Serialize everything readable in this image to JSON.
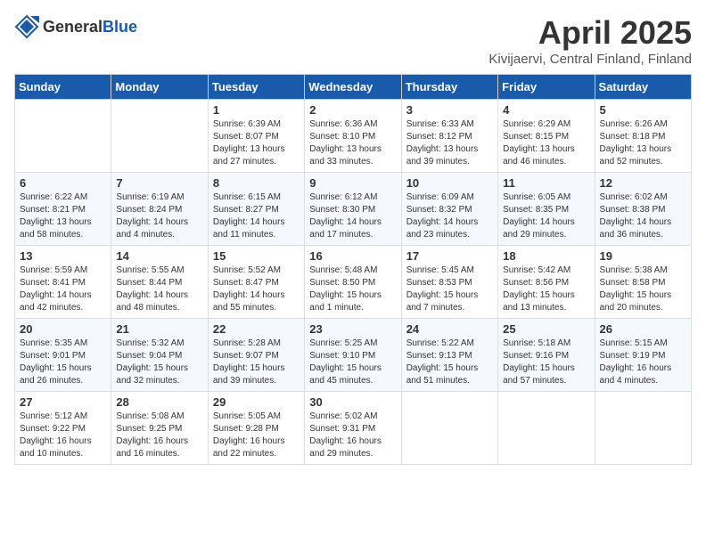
{
  "header": {
    "logo_general": "General",
    "logo_blue": "Blue",
    "month_title": "April 2025",
    "location": "Kivijaervi, Central Finland, Finland"
  },
  "weekdays": [
    "Sunday",
    "Monday",
    "Tuesday",
    "Wednesday",
    "Thursday",
    "Friday",
    "Saturday"
  ],
  "weeks": [
    [
      {
        "day": "",
        "info": ""
      },
      {
        "day": "",
        "info": ""
      },
      {
        "day": "1",
        "info": "Sunrise: 6:39 AM\nSunset: 8:07 PM\nDaylight: 13 hours and 27 minutes."
      },
      {
        "day": "2",
        "info": "Sunrise: 6:36 AM\nSunset: 8:10 PM\nDaylight: 13 hours and 33 minutes."
      },
      {
        "day": "3",
        "info": "Sunrise: 6:33 AM\nSunset: 8:12 PM\nDaylight: 13 hours and 39 minutes."
      },
      {
        "day": "4",
        "info": "Sunrise: 6:29 AM\nSunset: 8:15 PM\nDaylight: 13 hours and 46 minutes."
      },
      {
        "day": "5",
        "info": "Sunrise: 6:26 AM\nSunset: 8:18 PM\nDaylight: 13 hours and 52 minutes."
      }
    ],
    [
      {
        "day": "6",
        "info": "Sunrise: 6:22 AM\nSunset: 8:21 PM\nDaylight: 13 hours and 58 minutes."
      },
      {
        "day": "7",
        "info": "Sunrise: 6:19 AM\nSunset: 8:24 PM\nDaylight: 14 hours and 4 minutes."
      },
      {
        "day": "8",
        "info": "Sunrise: 6:15 AM\nSunset: 8:27 PM\nDaylight: 14 hours and 11 minutes."
      },
      {
        "day": "9",
        "info": "Sunrise: 6:12 AM\nSunset: 8:30 PM\nDaylight: 14 hours and 17 minutes."
      },
      {
        "day": "10",
        "info": "Sunrise: 6:09 AM\nSunset: 8:32 PM\nDaylight: 14 hours and 23 minutes."
      },
      {
        "day": "11",
        "info": "Sunrise: 6:05 AM\nSunset: 8:35 PM\nDaylight: 14 hours and 29 minutes."
      },
      {
        "day": "12",
        "info": "Sunrise: 6:02 AM\nSunset: 8:38 PM\nDaylight: 14 hours and 36 minutes."
      }
    ],
    [
      {
        "day": "13",
        "info": "Sunrise: 5:59 AM\nSunset: 8:41 PM\nDaylight: 14 hours and 42 minutes."
      },
      {
        "day": "14",
        "info": "Sunrise: 5:55 AM\nSunset: 8:44 PM\nDaylight: 14 hours and 48 minutes."
      },
      {
        "day": "15",
        "info": "Sunrise: 5:52 AM\nSunset: 8:47 PM\nDaylight: 14 hours and 55 minutes."
      },
      {
        "day": "16",
        "info": "Sunrise: 5:48 AM\nSunset: 8:50 PM\nDaylight: 15 hours and 1 minute."
      },
      {
        "day": "17",
        "info": "Sunrise: 5:45 AM\nSunset: 8:53 PM\nDaylight: 15 hours and 7 minutes."
      },
      {
        "day": "18",
        "info": "Sunrise: 5:42 AM\nSunset: 8:56 PM\nDaylight: 15 hours and 13 minutes."
      },
      {
        "day": "19",
        "info": "Sunrise: 5:38 AM\nSunset: 8:58 PM\nDaylight: 15 hours and 20 minutes."
      }
    ],
    [
      {
        "day": "20",
        "info": "Sunrise: 5:35 AM\nSunset: 9:01 PM\nDaylight: 15 hours and 26 minutes."
      },
      {
        "day": "21",
        "info": "Sunrise: 5:32 AM\nSunset: 9:04 PM\nDaylight: 15 hours and 32 minutes."
      },
      {
        "day": "22",
        "info": "Sunrise: 5:28 AM\nSunset: 9:07 PM\nDaylight: 15 hours and 39 minutes."
      },
      {
        "day": "23",
        "info": "Sunrise: 5:25 AM\nSunset: 9:10 PM\nDaylight: 15 hours and 45 minutes."
      },
      {
        "day": "24",
        "info": "Sunrise: 5:22 AM\nSunset: 9:13 PM\nDaylight: 15 hours and 51 minutes."
      },
      {
        "day": "25",
        "info": "Sunrise: 5:18 AM\nSunset: 9:16 PM\nDaylight: 15 hours and 57 minutes."
      },
      {
        "day": "26",
        "info": "Sunrise: 5:15 AM\nSunset: 9:19 PM\nDaylight: 16 hours and 4 minutes."
      }
    ],
    [
      {
        "day": "27",
        "info": "Sunrise: 5:12 AM\nSunset: 9:22 PM\nDaylight: 16 hours and 10 minutes."
      },
      {
        "day": "28",
        "info": "Sunrise: 5:08 AM\nSunset: 9:25 PM\nDaylight: 16 hours and 16 minutes."
      },
      {
        "day": "29",
        "info": "Sunrise: 5:05 AM\nSunset: 9:28 PM\nDaylight: 16 hours and 22 minutes."
      },
      {
        "day": "30",
        "info": "Sunrise: 5:02 AM\nSunset: 9:31 PM\nDaylight: 16 hours and 29 minutes."
      },
      {
        "day": "",
        "info": ""
      },
      {
        "day": "",
        "info": ""
      },
      {
        "day": "",
        "info": ""
      }
    ]
  ]
}
